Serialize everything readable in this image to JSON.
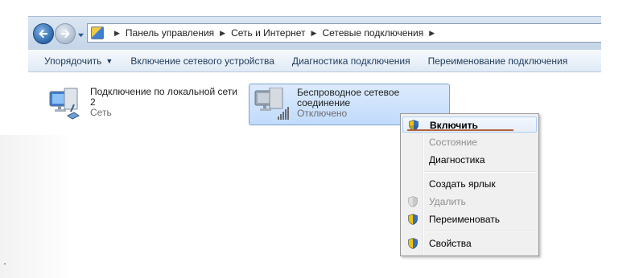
{
  "navigation": {
    "back_icon": "back-arrow-icon",
    "forward_icon": "forward-arrow-icon",
    "recent_pages_icon": "chevron-down-icon"
  },
  "address": {
    "location_icon": "control-panel-icon",
    "breadcrumbs": [
      "Панель управления",
      "Сеть и Интернет",
      "Сетевые подключения"
    ],
    "separator": "▶"
  },
  "toolbar": {
    "items": [
      {
        "label": "Упорядочить",
        "caret": "▼"
      },
      {
        "label": "Включение сетевого устройства"
      },
      {
        "label": "Диагностика подключения"
      },
      {
        "label": "Переименование подключения"
      }
    ]
  },
  "connections": [
    {
      "name_line1": "Подключение по локальной сети",
      "name_line2": "2",
      "status": "Сеть",
      "icon": "wired-network-icon"
    },
    {
      "name_line1": "Беспроводное сетевое",
      "name_line2": "соединение",
      "status": "Отключено",
      "icon": "wireless-network-icon",
      "selected": true
    }
  ],
  "context_menu": {
    "items": [
      {
        "label": "Включить",
        "bold": true,
        "highlighted": true,
        "icon": "uac-shield-icon"
      },
      {
        "label": "Состояние",
        "disabled": true
      },
      {
        "label": "Диагностика"
      },
      {
        "label": "Создать ярлык"
      },
      {
        "label": "Удалить",
        "disabled": true,
        "icon": "uac-shield-icon"
      },
      {
        "label": "Переименовать",
        "icon": "uac-shield-icon"
      },
      {
        "label": "Свойства",
        "icon": "uac-shield-icon"
      }
    ]
  },
  "colors": {
    "selection_fill": "#c1dbfc",
    "selection_border": "#7da2ce",
    "annotation_underline": "#b5603a",
    "toolbar_text": "#1e395b"
  }
}
